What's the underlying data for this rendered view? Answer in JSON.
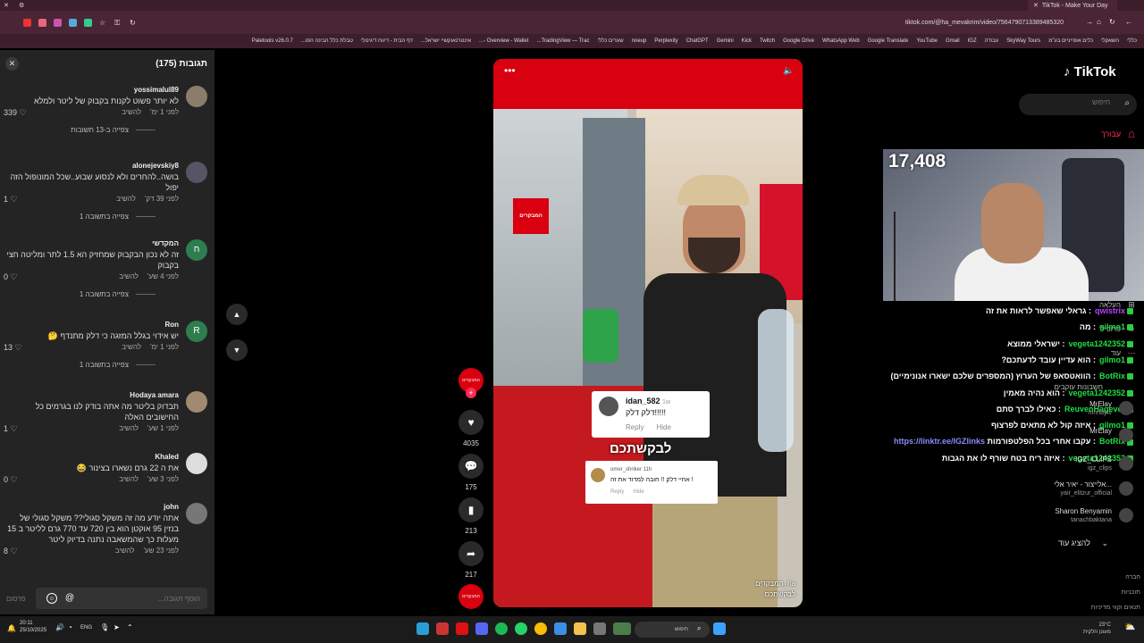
{
  "browser": {
    "tab_title": "TikTok - Make Your Day",
    "url": "tiktok.com/@ha_mevakrim/video/7564790713389485320",
    "bookmarks": [
      "Paletools v26.0.7",
      "טבלת כלל הבינה הפו...",
      "דף הבית - דיווח דיגיטלי",
      "אינטרנאוקשיי ישראל...",
      "Overview - Wallet -...",
      "TradingView — Trac...",
      "שערים כללי",
      "noeup",
      "Perplexity",
      "ChatGPT",
      "Gemini",
      "Kick",
      "Twitch",
      "Google Drive",
      "WhatsApp Web",
      "Google Translate",
      "YouTube",
      "Gmail",
      "IGZ",
      "עבודה",
      "SkyWay Tours",
      "כלים אופייניים בע\"מ",
      "השאקלי",
      "כללי"
    ]
  },
  "comments": {
    "title": "תגובות (175)",
    "input_placeholder": "הוסף תגובה...",
    "post_label": "פרסום",
    "items": [
      {
        "user": "yossimalul89",
        "text": "לא יותר פשוט לקנות בקבוק של ליטר ולמלא",
        "time": "לפני 1 ימ'",
        "reply": "להשיב",
        "likes": "339",
        "more": "צפייה ב-13 תשובות"
      },
      {
        "user": "alonejevskiy8",
        "text": "בושה..להחרים ולא לנסוע שבוע..שכל המונופול הזה יפול",
        "time": "לפני 39 דק'",
        "reply": "להשיב",
        "likes": "1",
        "more": "צפייה בתשובה 1"
      },
      {
        "user": "המקדשי",
        "avatar_letter": "ח",
        "text": "זה לא נכון הבקבוק שמחזיק הא 1.5 לתר ומליטה חצי בקבוק",
        "time": "לפני 4 שע'",
        "reply": "להשיב",
        "likes": "0",
        "more": "צפייה בתשובה 1"
      },
      {
        "user": "Ron",
        "avatar_letter": "R",
        "text": "יש אידוי בגלל המזגה כי דלק מתנדף 🤔",
        "time": "לפני 1 ימ'",
        "reply": "להשיב",
        "likes": "13",
        "more": "צפייה בתשובה 1"
      },
      {
        "user": "Hodaya amara",
        "text": "תבדוק בליטר מה אתה בודק לנו בגרמים כל החישובים האלה",
        "time": "לפני 1 שע'",
        "reply": "להשיב",
        "likes": "1",
        "more": ""
      },
      {
        "user": "Khaled",
        "text": "את ה 22 גרם נשארו בצינור 😂",
        "time": "לפני 3 שע'",
        "reply": "להשיב",
        "likes": "0",
        "more": ""
      },
      {
        "user": "john",
        "text": "אתה יודע מה זה משקל סגולי?? משקל סגולי של בנזין 95 אוקטן הוא בין 720 עד 770 גרם לליטר ב 15 מעלות כך שהמשאבה נתנה בדיוק ליטר",
        "time": "לפני 23 שע'",
        "reply": "להשיב",
        "likes": "8",
        "more": ""
      }
    ]
  },
  "video": {
    "logo_text": "המבקרים",
    "card1": {
      "user": "idan_582",
      "age": "1w",
      "text": "דלק דלק!!!!!",
      "reply": "Reply",
      "hide": "Hide"
    },
    "overlay_text": "לבקשתכם",
    "card2": {
      "user": "omer_shriker",
      "age": "11h",
      "text": "אחיי דלק !! חובה למדוד את זה !",
      "reply": "Reply",
      "hide": "Hide"
    },
    "caption_lines": [
      "המבקרים_ha",
      "לבקשתכם"
    ]
  },
  "actions": {
    "avatar_text": "המבקרים",
    "likes": "4035",
    "comments": "175",
    "saves": "213",
    "shares": "217"
  },
  "right": {
    "brand": "TikTok",
    "search_placeholder": "חיפוש",
    "for_you": "עבורך",
    "nav": [
      "העלאה",
      "פרופיל",
      "עוד"
    ],
    "following_label": "חשבונות עוקבים",
    "viewers": "17,408",
    "chat": [
      {
        "name": "qwistrix",
        "name_color": "#bb44ff",
        "text": "גראלי שאפשר לראות את זה"
      },
      {
        "name": "gilmo1",
        "name_color": "#22dd44",
        "text": "מה"
      },
      {
        "name": "vegeta1242352",
        "name_color": "#22dd44",
        "text": "ישראלי ממוצא"
      },
      {
        "name": "gilmo1",
        "name_color": "#22dd44",
        "text": "הוא עדיין עובד לדעתכם?"
      },
      {
        "name": "BotRix",
        "name_color": "#22dd44",
        "text": "הוואטסאפ של הערוץ (המספרים שלכם ישארו אנונימיים)"
      },
      {
        "name": "vegeta1242352",
        "name_color": "#22dd44",
        "text": "הוא נהיה מאמין"
      },
      {
        "name": "ReuvenHagever",
        "name_color": "#22dd44",
        "text": "כאילו לברך סתם"
      },
      {
        "name": "gilmo1",
        "name_color": "#22dd44",
        "text": "איזה קול לא מתאים לפרצוף"
      },
      {
        "name": "BotRix",
        "name_color": "#22dd44",
        "text": "עקבו אחרי בכל הפלטפורמות",
        "link": "https://linktr.ee/IGZlinks"
      },
      {
        "name": "vegeta1242352",
        "name_color": "#22dd44",
        "text": "איזה ריח בטח שורף לו את הגבות"
      }
    ],
    "side_users": [
      {
        "name": "MrElay",
        "handle": "mrelaytv"
      },
      {
        "name": "MrElay",
        "handle": ""
      },
      {
        "name": "IGZ_CLIPS",
        "handle": "igz_clips"
      },
      {
        "name": "אלייצור - יאיר אלי...",
        "handle": "yair_elitzur_official"
      },
      {
        "name": "Sharon Benyamin",
        "handle": "tanachbaktana"
      }
    ],
    "show_more": "להציג עוד",
    "footer": [
      "חברה",
      "תוכניות",
      "תנאים וקווי מדיניות"
    ]
  },
  "taskbar": {
    "time": "20:11",
    "date": "25/10/2025",
    "lang": "ENG",
    "search": "חיפוש",
    "weather_temp": "23°C",
    "weather_desc": "מעונן חלקית"
  }
}
